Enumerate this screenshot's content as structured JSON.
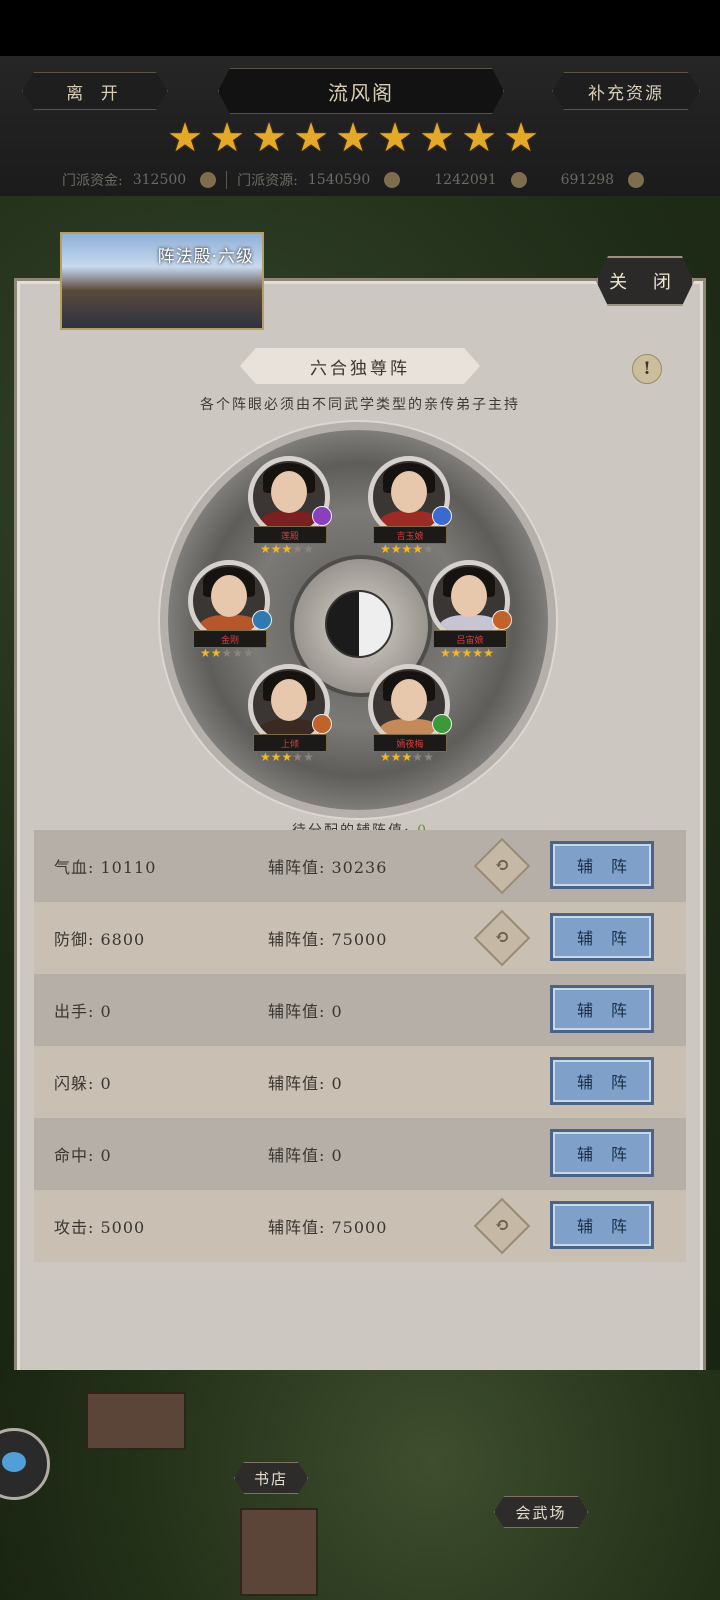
{
  "header": {
    "leave_label": "离 开",
    "title": "流风阁",
    "replenish_label": "补充资源",
    "star_count": 9,
    "resources": {
      "sect_funds_label": "门派资金:",
      "sect_funds_value": "312500",
      "sect_resources_label": "门派资源:",
      "sect_resources_value": "1540590",
      "res2_value": "1242091",
      "res3_value": "691298"
    }
  },
  "panel": {
    "building_label": "阵法殿·六级",
    "close_label": "关 闭",
    "formation_name": "六合独尊阵",
    "hint": "各个阵眼必须由不同武学类型的亲传弟子主持",
    "pending_label": "待分配的辅阵值:",
    "pending_value": "0"
  },
  "heroes": [
    {
      "name": "莲殿",
      "stars": 3,
      "badge_color": "#8a3fbf",
      "robe": "#7a1f22"
    },
    {
      "name": "吉玉娘",
      "stars": 4,
      "badge_color": "#3a6ad0",
      "robe": "#9b2b24"
    },
    {
      "name": "金刚",
      "stars": 2,
      "badge_color": "#2f7ab0",
      "robe": "#b5572a"
    },
    {
      "name": "吕宙娘",
      "stars": 5,
      "badge_color": "#c0622a",
      "robe": "#c7c4d4"
    },
    {
      "name": "上倾",
      "stars": 3,
      "badge_color": "#c0622a",
      "robe": "#3a2a22"
    },
    {
      "name": "嫣夜梅",
      "stars": 3,
      "badge_color": "#3a9a3a",
      "robe": "#c48a5a"
    }
  ],
  "stats": [
    {
      "label": "气血:",
      "value": "10110",
      "assist_label": "辅阵值:",
      "assist_value": "30236",
      "has_swap": true,
      "button": "辅阵"
    },
    {
      "label": "防御:",
      "value": "6800",
      "assist_label": "辅阵值:",
      "assist_value": "75000",
      "has_swap": true,
      "button": "辅阵"
    },
    {
      "label": "出手:",
      "value": "0",
      "assist_label": "辅阵值:",
      "assist_value": "0",
      "has_swap": false,
      "button": "辅阵"
    },
    {
      "label": "闪躲:",
      "value": "0",
      "assist_label": "辅阵值:",
      "assist_value": "0",
      "has_swap": false,
      "button": "辅阵"
    },
    {
      "label": "命中:",
      "value": "0",
      "assist_label": "辅阵值:",
      "assist_value": "0",
      "has_swap": false,
      "button": "辅阵"
    },
    {
      "label": "攻击:",
      "value": "5000",
      "assist_label": "辅阵值:",
      "assist_value": "75000",
      "has_swap": true,
      "button": "辅阵"
    }
  ],
  "map": {
    "bookstore_label": "书店",
    "arena_label": "会武场"
  },
  "colors": {
    "star_gold": "#e4a928",
    "assist_button": "#7ea0c9",
    "pending_green": "#4e9a3a"
  }
}
